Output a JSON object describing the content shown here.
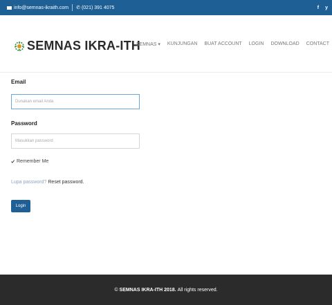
{
  "topbar": {
    "email": "info@semnas-ikraith.com",
    "phone": "(021) 391 4075",
    "social": [
      "f",
      "y"
    ]
  },
  "header": {
    "brand": "SEMNAS IKRA-ITH",
    "nav": [
      "SEMNAS ▾",
      "KUNJUNGAN",
      "BUAT ACCOUNT",
      "LOGIN",
      "DOWNLOAD",
      "CONTACT"
    ]
  },
  "form": {
    "email_label": "Email",
    "email_placeholder": "Dunakan email Anda",
    "password_label": "Password",
    "password_placeholder": "Masukkan password",
    "remember_label": "Remember Me",
    "forgot_question": "Lupa password?",
    "forgot_link": "Reset password.",
    "login_button": "Login"
  },
  "footer": {
    "brand": "SEMNAS IKRA-ITH 2018.",
    "rights": "All rights reserved."
  },
  "colors": {
    "primary": "#1e5f95",
    "footer_bg": "#2b2b2b"
  }
}
